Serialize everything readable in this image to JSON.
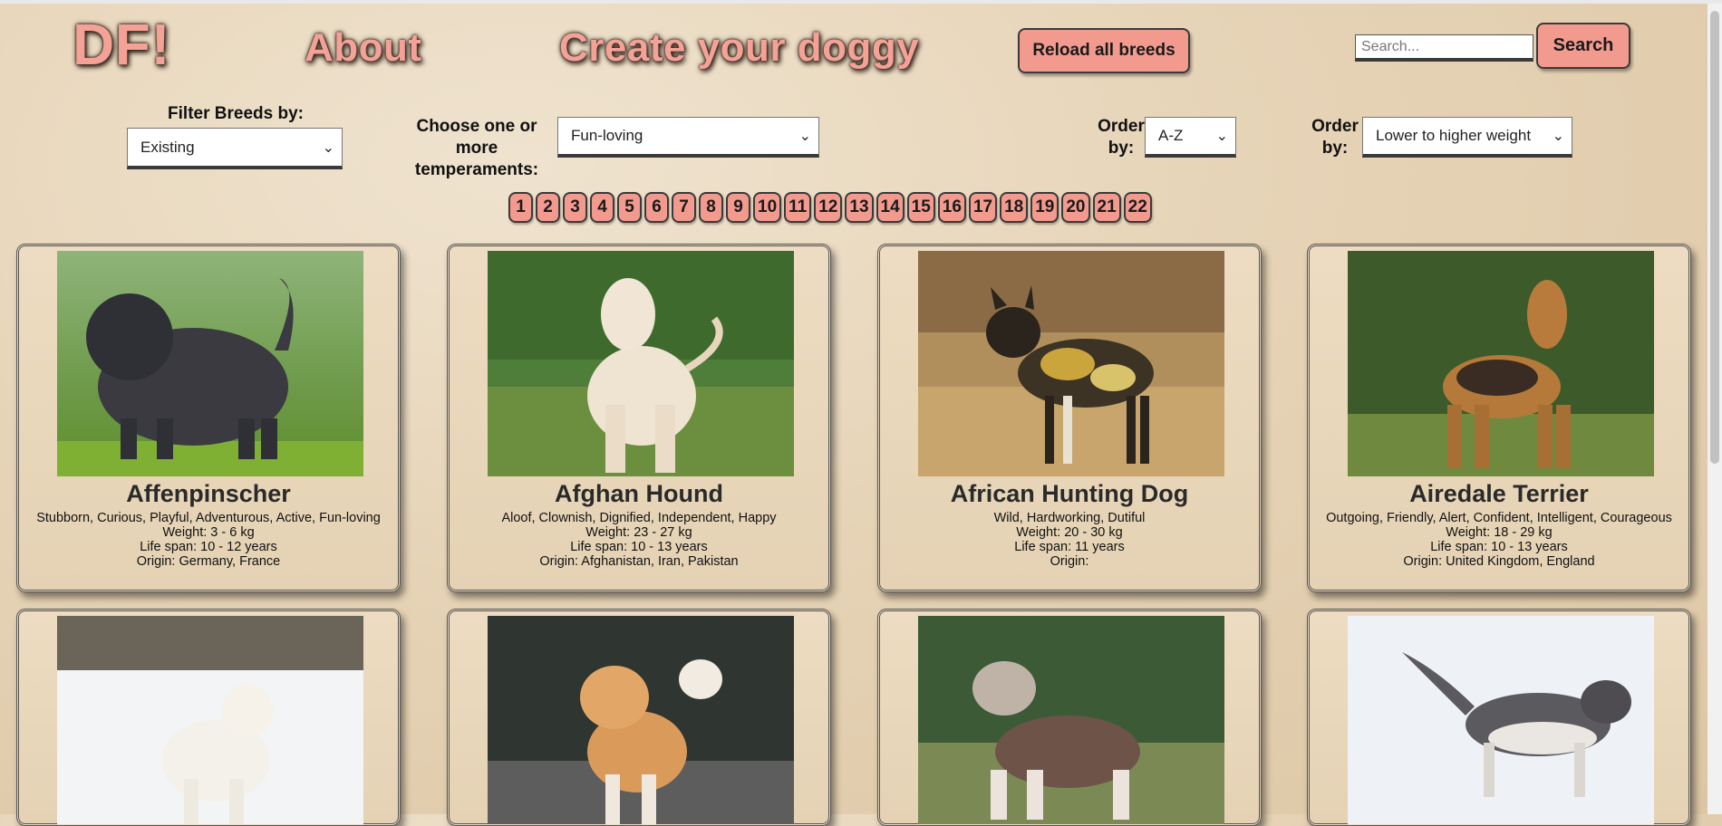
{
  "nav": {
    "logo": "DF!",
    "about": "About",
    "create": "Create your doggy",
    "reload_label": "Reload all breeds",
    "search_placeholder": "Search...",
    "search_label": "Search"
  },
  "filters": {
    "filter_label": "Filter Breeds by:",
    "filter_value": "Existing",
    "temperament_label": "Choose one or more temperaments:",
    "temperament_value": "Fun-loving",
    "order_label": "Order by:",
    "order_az_value": "A-Z",
    "order_weight_label": "Order by:",
    "order_weight_value": "Lower to higher weight"
  },
  "pagination": [
    "1",
    "2",
    "3",
    "4",
    "5",
    "6",
    "7",
    "8",
    "9",
    "10",
    "11",
    "12",
    "13",
    "14",
    "15",
    "16",
    "17",
    "18",
    "19",
    "20",
    "21",
    "22"
  ],
  "cards": [
    {
      "name": "Affenpinscher",
      "temperament": "Stubborn, Curious, Playful, Adventurous, Active, Fun-loving",
      "weight": "Weight: 3 - 6 kg",
      "life_span": "Life span: 10 - 12 years",
      "origin": "Origin: Germany, France"
    },
    {
      "name": "Afghan Hound",
      "temperament": "Aloof, Clownish, Dignified, Independent, Happy",
      "weight": "Weight: 23 - 27 kg",
      "life_span": "Life span: 10 - 13 years",
      "origin": "Origin: Afghanistan, Iran, Pakistan"
    },
    {
      "name": "African Hunting Dog",
      "temperament": "Wild, Hardworking, Dutiful",
      "weight": "Weight: 20 - 30 kg",
      "life_span": "Life span: 11 years",
      "origin": "Origin:"
    },
    {
      "name": "Airedale Terrier",
      "temperament": "Outgoing, Friendly, Alert, Confident, Intelligent, Courageous",
      "weight": "Weight: 18 - 29 kg",
      "life_span": "Life span: 10 - 13 years",
      "origin": "Origin: United Kingdom, England"
    }
  ],
  "colors": {
    "accent": "#f29a8e",
    "title": "#f4a196"
  }
}
